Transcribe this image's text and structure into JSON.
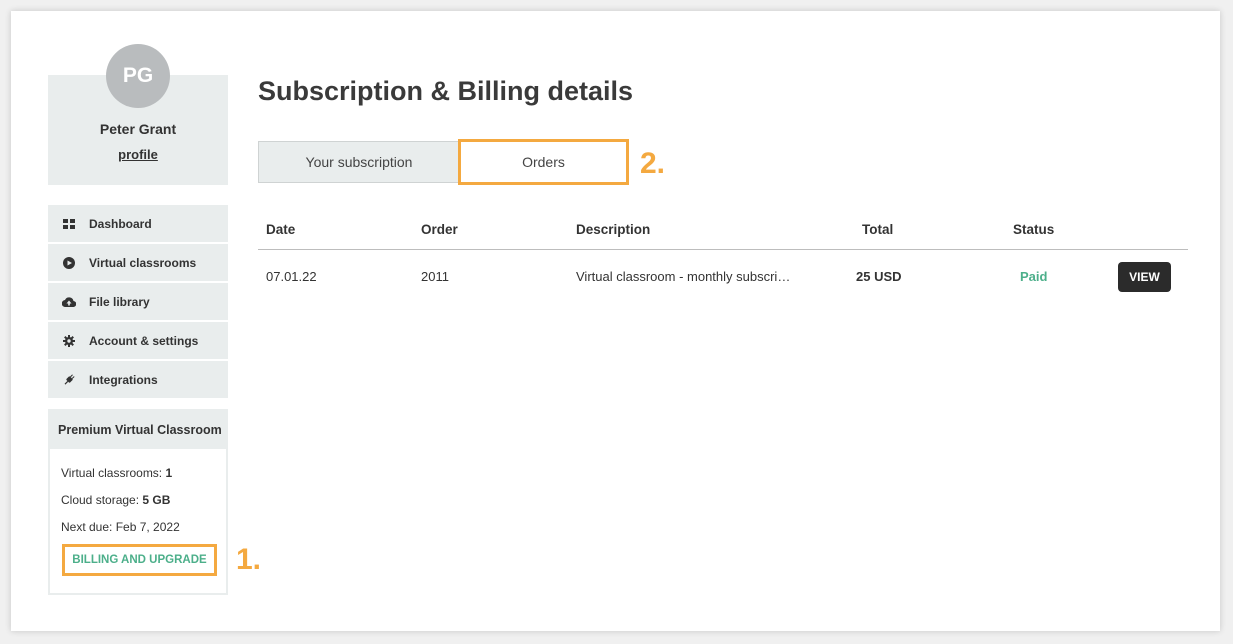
{
  "profile": {
    "initials": "PG",
    "name": "Peter Grant",
    "link_label": "profile"
  },
  "nav": {
    "items": [
      {
        "label": "Dashboard",
        "icon": "dashboard-grid-icon"
      },
      {
        "label": "Virtual classrooms",
        "icon": "play-circle-icon"
      },
      {
        "label": "File library",
        "icon": "cloud-upload-icon"
      },
      {
        "label": "Account & settings",
        "icon": "gear-icon"
      },
      {
        "label": "Integrations",
        "icon": "plug-icon"
      }
    ]
  },
  "plan": {
    "title": "Premium Virtual Classroom",
    "classrooms_label": "Virtual classrooms: ",
    "classrooms_value": "1",
    "storage_label": "Cloud storage: ",
    "storage_value": "5 GB",
    "next_due": "Next due: Feb 7, 2022",
    "upgrade_label": "BILLING AND UPGRADE"
  },
  "callouts": {
    "one": "1.",
    "two": "2."
  },
  "main": {
    "title": "Subscription & Billing details",
    "tabs": [
      "Your subscription",
      "Orders"
    ],
    "columns": [
      "Date",
      "Order",
      "Description",
      "Total",
      "Status"
    ],
    "rows": [
      {
        "date": "07.01.22",
        "order": "2011",
        "description": "Virtual classroom - monthly subscri…",
        "total": "25 USD",
        "status": "Paid",
        "action": "VIEW"
      }
    ]
  },
  "colors": {
    "highlight": "#f4a940",
    "paid": "#4caf8a",
    "panel": "#e9eded",
    "view_button": "#2b2b2b"
  }
}
